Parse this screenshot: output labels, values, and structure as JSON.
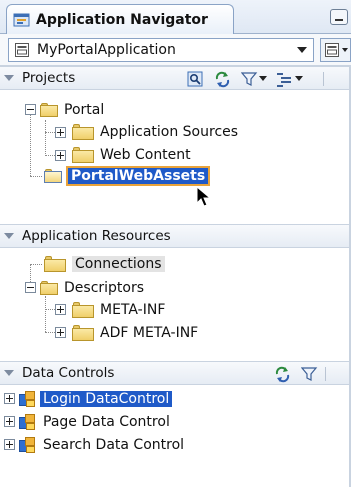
{
  "panel": {
    "title": "Application Navigator"
  },
  "app_selector": {
    "value": "MyPortalApplication"
  },
  "projects": {
    "header": "Projects",
    "tree": {
      "root": "Portal",
      "children": [
        "Application Sources",
        "Web Content"
      ],
      "sibling_selected": "PortalWebAssets"
    }
  },
  "application_resources": {
    "header": "Application Resources",
    "items": [
      "Connections",
      "Descriptors"
    ],
    "descriptor_children": [
      "META-INF",
      "ADF META-INF"
    ]
  },
  "data_controls": {
    "header": "Data Controls",
    "items": [
      "Login DataControl",
      "Page Data Control",
      "Search Data Control"
    ]
  },
  "icons": {
    "navigator": "navigator-icon",
    "app": "application-icon",
    "folder": "folder-icon",
    "data_control": "data-control-icon",
    "refresh": "refresh-icon",
    "filter": "filter-icon",
    "find": "find-icon",
    "working_sets": "working-sets-icon",
    "minimize": "minimize-icon"
  },
  "colors": {
    "selection": "#1f5ac8",
    "selection_border": "#e9a33b",
    "folder": "#f0cf6a"
  }
}
